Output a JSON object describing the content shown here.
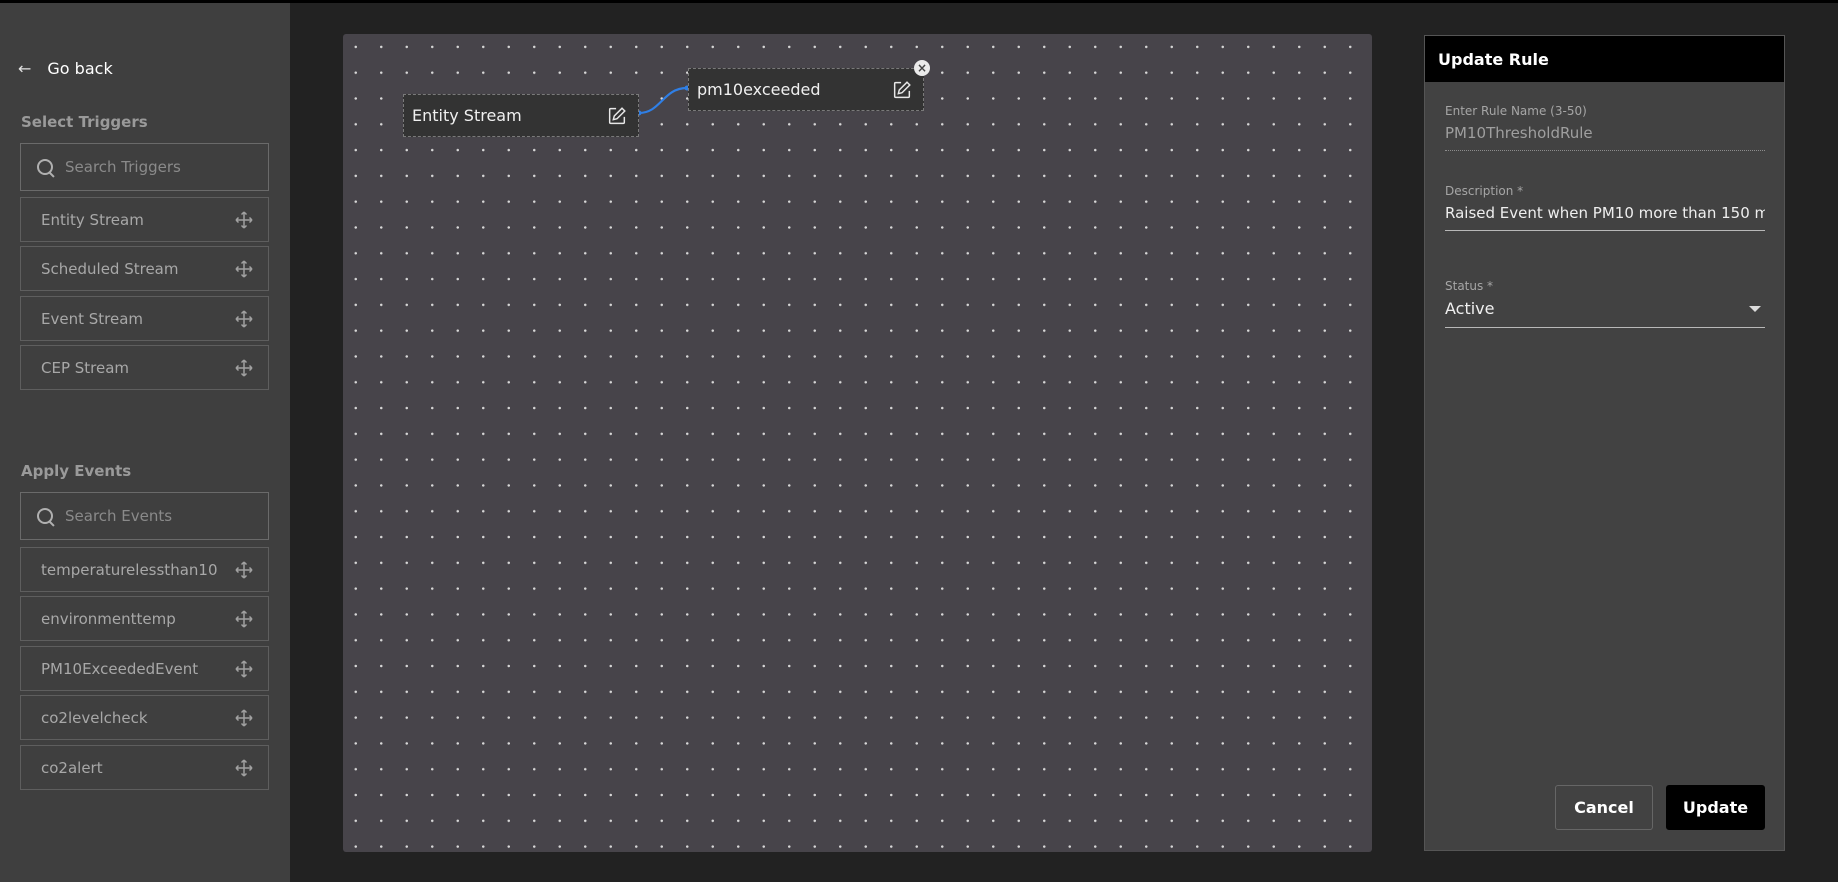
{
  "sidebar": {
    "go_back": "Go back",
    "triggers": {
      "title": "Select Triggers",
      "search_placeholder": "Search Triggers",
      "items": [
        {
          "label": "Entity Stream"
        },
        {
          "label": "Scheduled Stream"
        },
        {
          "label": "Event Stream"
        },
        {
          "label": "CEP Stream"
        }
      ]
    },
    "events": {
      "title": "Apply Events",
      "search_placeholder": "Search Events",
      "items": [
        {
          "label": "temperaturelessthan10"
        },
        {
          "label": "environmenttemp"
        },
        {
          "label": "PM10ExceededEvent"
        },
        {
          "label": "co2levelcheck"
        },
        {
          "label": "co2alert"
        }
      ]
    }
  },
  "canvas": {
    "nodes": [
      {
        "label": "Entity Stream"
      },
      {
        "label": "pm10exceeded"
      }
    ],
    "connector_color": "#2f7fe6"
  },
  "panel": {
    "title": "Update Rule",
    "rule_name": {
      "label": "Enter Rule Name (3-50)",
      "value": "PM10ThresholdRule"
    },
    "description": {
      "label": "Description *",
      "value": "Raised Event when PM10 more than 150 m"
    },
    "status": {
      "label": "Status *",
      "value": "Active"
    },
    "cancel_label": "Cancel",
    "update_label": "Update"
  }
}
